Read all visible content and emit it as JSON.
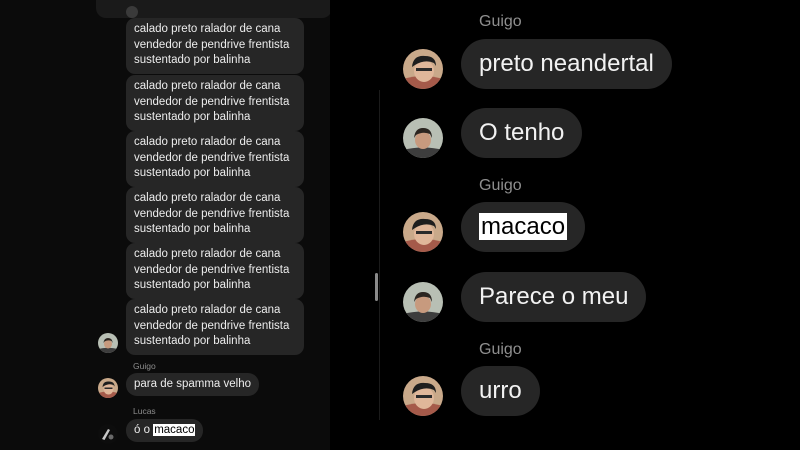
{
  "left": {
    "spam_text": "calado preto ralador de cana\nvendedor de pendrive frentista\nsustentado por balinha",
    "guigo_name": "Guigo",
    "guigo_message": "para de spamma velho",
    "lucas_name": "Lucas",
    "lucas_prefix": "ó o",
    "lucas_highlight": "macaco"
  },
  "right": {
    "sender1": "Guigo",
    "msg1": "preto neandertal",
    "msg2": "O tenho",
    "sender2": "Guigo",
    "msg3": "macaco",
    "msg4": "Parece o meu",
    "sender3": "Guigo",
    "msg5": "urro"
  },
  "colors": {
    "bubble": "#262626",
    "name_label": "#8f8f8f",
    "highlight_bg": "#ffffff"
  },
  "icons": [
    "avatar-guigo",
    "avatar-other",
    "avatar-lucas"
  ]
}
